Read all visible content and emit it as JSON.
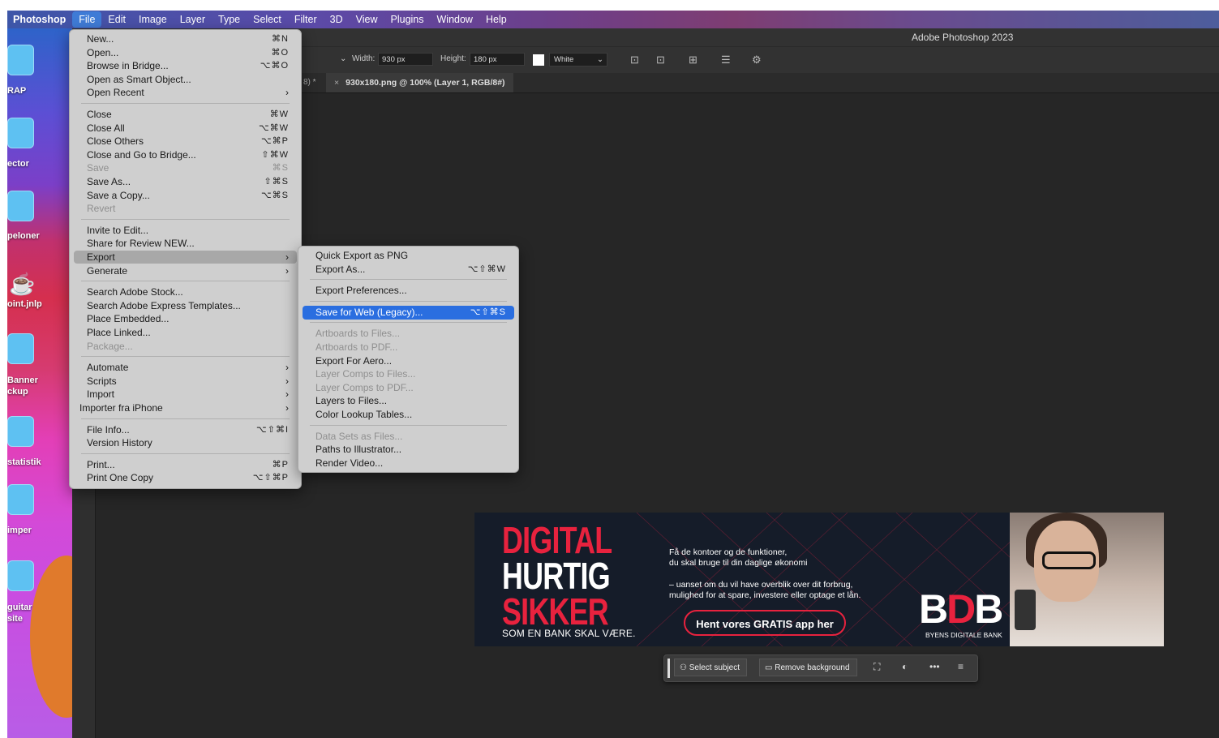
{
  "menubar": {
    "items": [
      "Photoshop",
      "File",
      "Edit",
      "Image",
      "Layer",
      "Type",
      "Select",
      "Filter",
      "3D",
      "View",
      "Plugins",
      "Window",
      "Help"
    ],
    "active": "File"
  },
  "window": {
    "title": "Adobe Photoshop 2023"
  },
  "options": {
    "width_label": "Width:",
    "width_value": "930 px",
    "height_label": "Height:",
    "height_value": "180 px",
    "fill_value": "White"
  },
  "tabs": {
    "previous_suffix": "8) *",
    "active": "930x180.png @ 100% (Layer 1, RGB/8#)"
  },
  "desktop": {
    "labels": [
      "RAP",
      "ector",
      "peloner",
      "oint.jnlp",
      "Banner\nckup",
      "statistik",
      "imper",
      "guitar\nsite"
    ]
  },
  "file_menu": {
    "groups": [
      [
        {
          "label": "New...",
          "sc": "⌘N"
        },
        {
          "label": "Open...",
          "sc": "⌘O"
        },
        {
          "label": "Browse in Bridge...",
          "sc": "⌥⌘O"
        },
        {
          "label": "Open as Smart Object...",
          "sc": ""
        },
        {
          "label": "Open Recent",
          "sc": "",
          "sub": true
        }
      ],
      [
        {
          "label": "Close",
          "sc": "⌘W"
        },
        {
          "label": "Close All",
          "sc": "⌥⌘W"
        },
        {
          "label": "Close Others",
          "sc": "⌥⌘P"
        },
        {
          "label": "Close and Go to Bridge...",
          "sc": "⇧⌘W"
        },
        {
          "label": "Save",
          "sc": "⌘S",
          "dis": true
        },
        {
          "label": "Save As...",
          "sc": "⇧⌘S"
        },
        {
          "label": "Save a Copy...",
          "sc": "⌥⌘S"
        },
        {
          "label": "Revert",
          "sc": "",
          "dis": true
        }
      ],
      [
        {
          "label": "Invite to Edit...",
          "sc": ""
        },
        {
          "label": "Share for Review NEW...",
          "sc": ""
        },
        {
          "label": "Export",
          "sc": "",
          "sub": true,
          "hl": true
        },
        {
          "label": "Generate",
          "sc": "",
          "sub": true
        }
      ],
      [
        {
          "label": "Search Adobe Stock...",
          "sc": ""
        },
        {
          "label": "Search Adobe Express Templates...",
          "sc": ""
        },
        {
          "label": "Place Embedded...",
          "sc": ""
        },
        {
          "label": "Place Linked...",
          "sc": ""
        },
        {
          "label": "Package...",
          "sc": "",
          "dis": true
        }
      ],
      [
        {
          "label": "Automate",
          "sc": "",
          "sub": true
        },
        {
          "label": "Scripts",
          "sc": "",
          "sub": true
        },
        {
          "label": "Import",
          "sc": "",
          "sub": true
        },
        {
          "label": "Importer fra iPhone",
          "sc": "",
          "sub": true,
          "outdent": true
        }
      ],
      [
        {
          "label": "File Info...",
          "sc": "⌥⇧⌘I"
        },
        {
          "label": "Version History",
          "sc": ""
        }
      ],
      [
        {
          "label": "Print...",
          "sc": "⌘P"
        },
        {
          "label": "Print One Copy",
          "sc": "⌥⇧⌘P"
        }
      ]
    ]
  },
  "export_menu": {
    "groups": [
      [
        {
          "label": "Quick Export as PNG",
          "sc": ""
        },
        {
          "label": "Export As...",
          "sc": "⌥⇧⌘W"
        }
      ],
      [
        {
          "label": "Export Preferences...",
          "sc": ""
        }
      ],
      [
        {
          "label": "Save for Web (Legacy)...",
          "sc": "⌥⇧⌘S",
          "sel": true
        }
      ],
      [
        {
          "label": "Artboards to Files...",
          "sc": "",
          "dis": true
        },
        {
          "label": "Artboards to PDF...",
          "sc": "",
          "dis": true
        },
        {
          "label": "Export For Aero...",
          "sc": ""
        },
        {
          "label": "Layer Comps to Files...",
          "sc": "",
          "dis": true
        },
        {
          "label": "Layer Comps to PDF...",
          "sc": "",
          "dis": true
        },
        {
          "label": "Layers to Files...",
          "sc": ""
        },
        {
          "label": "Color Lookup Tables...",
          "sc": ""
        }
      ],
      [
        {
          "label": "Data Sets as Files...",
          "sc": "",
          "dis": true
        },
        {
          "label": "Paths to Illustrator...",
          "sc": ""
        },
        {
          "label": "Render Video...",
          "sc": ""
        }
      ]
    ]
  },
  "banner": {
    "line1": "DIGITAL",
    "line2": "HURTIG",
    "line3": "SIKKER",
    "tagline": "SOM EN BANK SKAL VÆRE.",
    "copy1a": "Få de kontoer og de funktioner,",
    "copy1b": "du skal bruge til din daglige økonomi",
    "copy2a": "– uanset om du vil have overblik over dit forbrug,",
    "copy2b": "mulighed for at spare, investere eller optage et lån.",
    "cta": "Hent vores GRATIS app her",
    "logo_b1": "B",
    "logo_d": "D",
    "logo_b2": "B",
    "logo_sub": "BYENS DIGITALE BANK"
  },
  "taskbar": {
    "select_subject": "Select subject",
    "remove_background": "Remove background"
  }
}
